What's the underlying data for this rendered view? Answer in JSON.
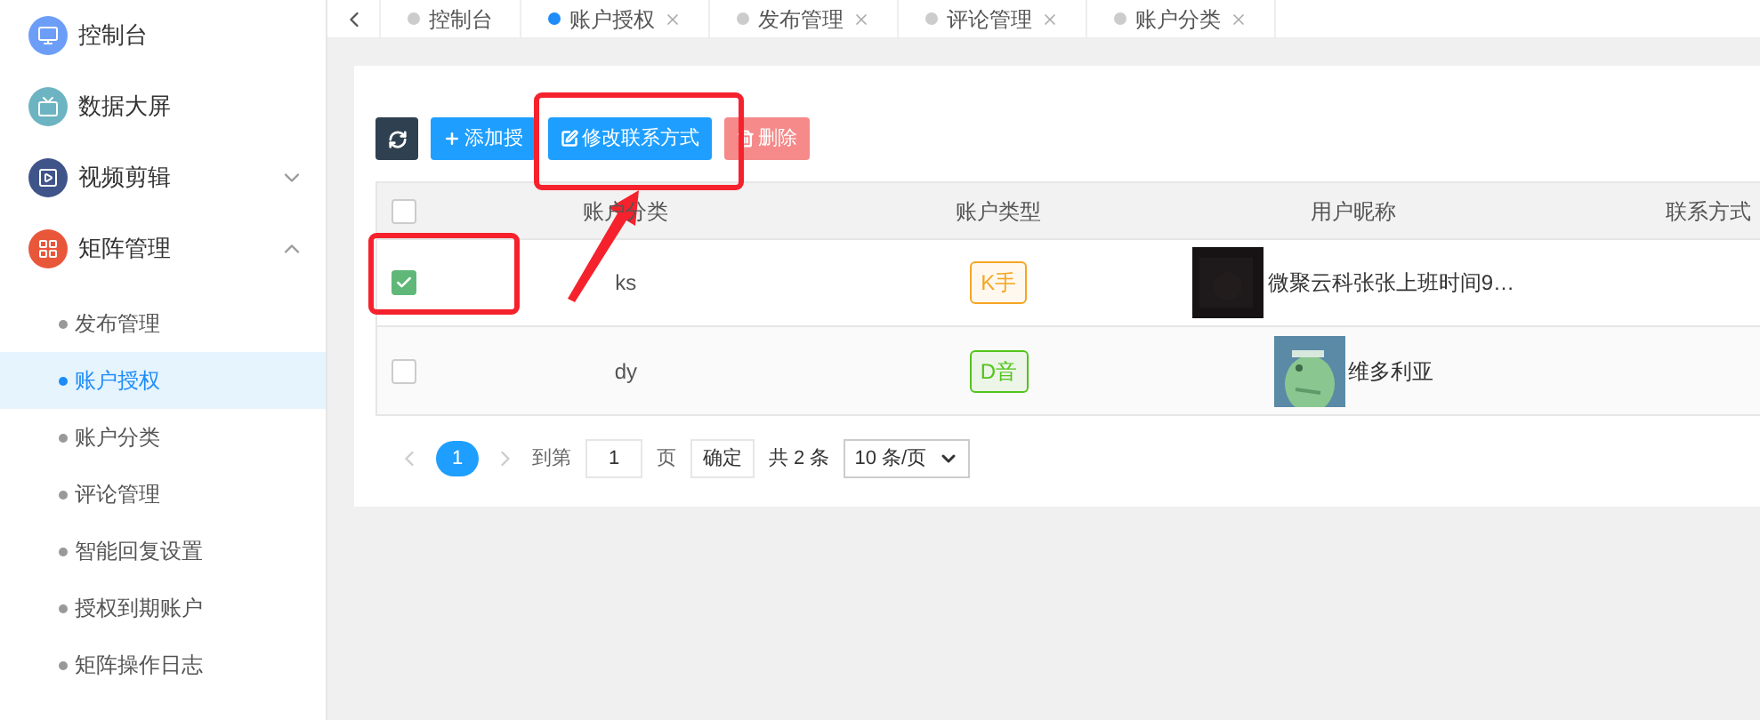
{
  "sidebar": {
    "items": [
      {
        "label": "控制台",
        "color": "#6c9ef8"
      },
      {
        "label": "数据大屏",
        "color": "#6cb4c1"
      },
      {
        "label": "视频剪辑",
        "color": "#3f5489",
        "expanded": false
      },
      {
        "label": "矩阵管理",
        "color": "#e9573b",
        "expanded": true,
        "children": [
          {
            "label": "发布管理",
            "selected": false
          },
          {
            "label": "账户授权",
            "selected": true
          },
          {
            "label": "账户分类",
            "selected": false
          },
          {
            "label": "评论管理",
            "selected": false
          },
          {
            "label": "智能回复设置",
            "selected": false
          },
          {
            "label": "授权到期账户",
            "selected": false
          },
          {
            "label": "矩阵操作日志",
            "selected": false
          }
        ]
      }
    ]
  },
  "tabs": [
    {
      "label": "控制台",
      "selected": false,
      "closable": false
    },
    {
      "label": "账户授权",
      "selected": true,
      "closable": true
    },
    {
      "label": "发布管理",
      "selected": false,
      "closable": true
    },
    {
      "label": "评论管理",
      "selected": false,
      "closable": true
    },
    {
      "label": "账户分类",
      "selected": false,
      "closable": true
    }
  ],
  "toolbar": {
    "buttons": [
      {
        "kind": "refresh"
      },
      {
        "kind": "add",
        "label": "添加授"
      },
      {
        "kind": "edit",
        "label": "修改联系方式"
      },
      {
        "kind": "delete",
        "label": "删除"
      }
    ]
  },
  "table": {
    "all_checked": false,
    "columns": [
      "账户分类",
      "账户类型",
      "用户昵称",
      "联系方式"
    ],
    "rows": [
      {
        "checked": true,
        "category": "ks",
        "type": "K手",
        "color": "#f5a623",
        "nickname": "微聚云科张张上班时间9…"
      },
      {
        "checked": false,
        "category": "dy",
        "type": "D音",
        "color": "#52c41a",
        "nickname": "维多利亚"
      }
    ]
  },
  "pagination": {
    "page": "1",
    "goto_label": "到第",
    "goto_value": "1",
    "page_unit": "页",
    "confirm": "确定",
    "total": "共 2 条",
    "page_size": "10 条/页"
  }
}
